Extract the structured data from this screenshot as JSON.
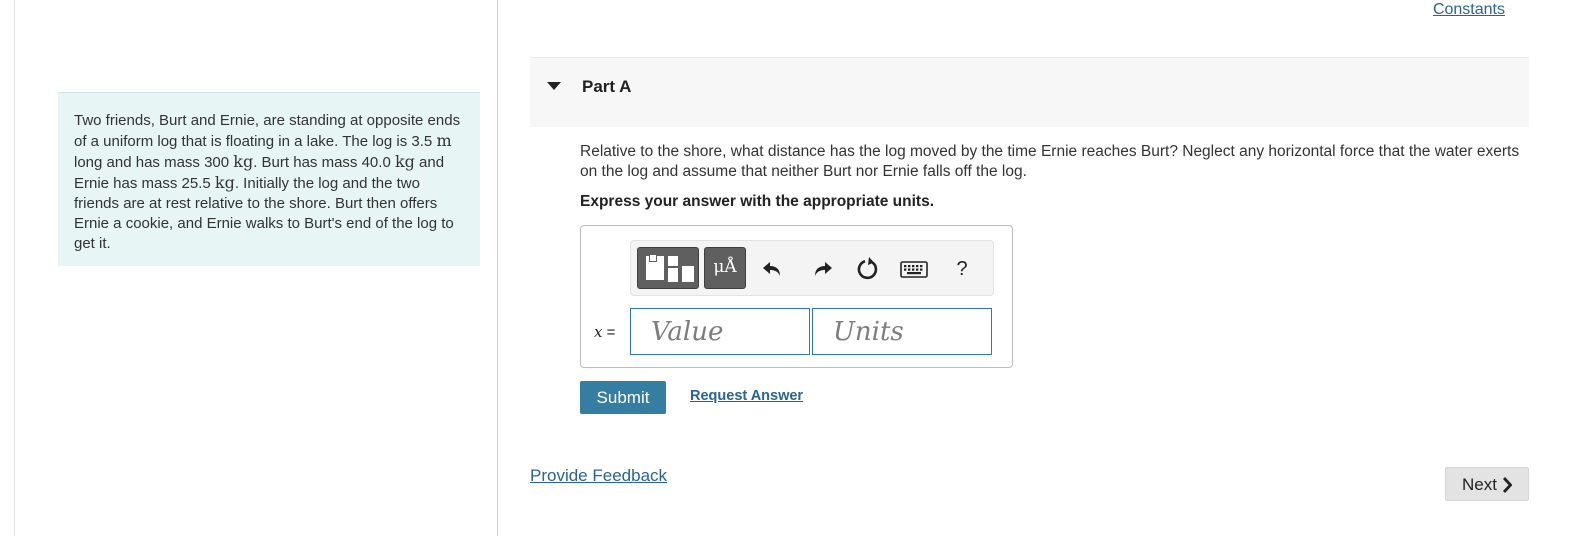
{
  "header": {
    "constants_link": "Constants"
  },
  "problem": {
    "parts": [
      "Two friends, Burt and Ernie, are standing at opposite ends of a uniform log that is floating in a lake. The log is 3.5 ",
      "m",
      " long and has mass 300 ",
      "kg",
      ". Burt has mass 40.0 ",
      "kg",
      " and Ernie has mass 25.5 ",
      "kg",
      ". Initially the log and the two friends are at rest relative to the shore. Burt then offers Ernie a cookie, and Ernie walks to Burt's end of the log to get it."
    ]
  },
  "part": {
    "title": "Part A",
    "question": "Relative to the shore, what distance has the log moved by the time Ernie reaches Burt? Neglect any horizontal force that the water exerts on the log and assume that neither Burt nor Ernie falls off the log.",
    "instruction": "Express your answer with the appropriate units."
  },
  "toolbar": {
    "templates_icon": "templates-icon",
    "units_label": "μÅ",
    "help_label": "?"
  },
  "answer": {
    "variable": "x",
    "equals": " =",
    "value_placeholder": "Value",
    "units_placeholder": "Units"
  },
  "actions": {
    "submit_label": "Submit",
    "request_answer_label": "Request Answer",
    "feedback_label": "Provide Feedback",
    "next_label": "Next"
  },
  "colors": {
    "accent_blue": "#367da2",
    "link_blue": "#2a6496",
    "problem_bg": "#e7f5f4",
    "part_header_bg": "#f7f7f7"
  }
}
